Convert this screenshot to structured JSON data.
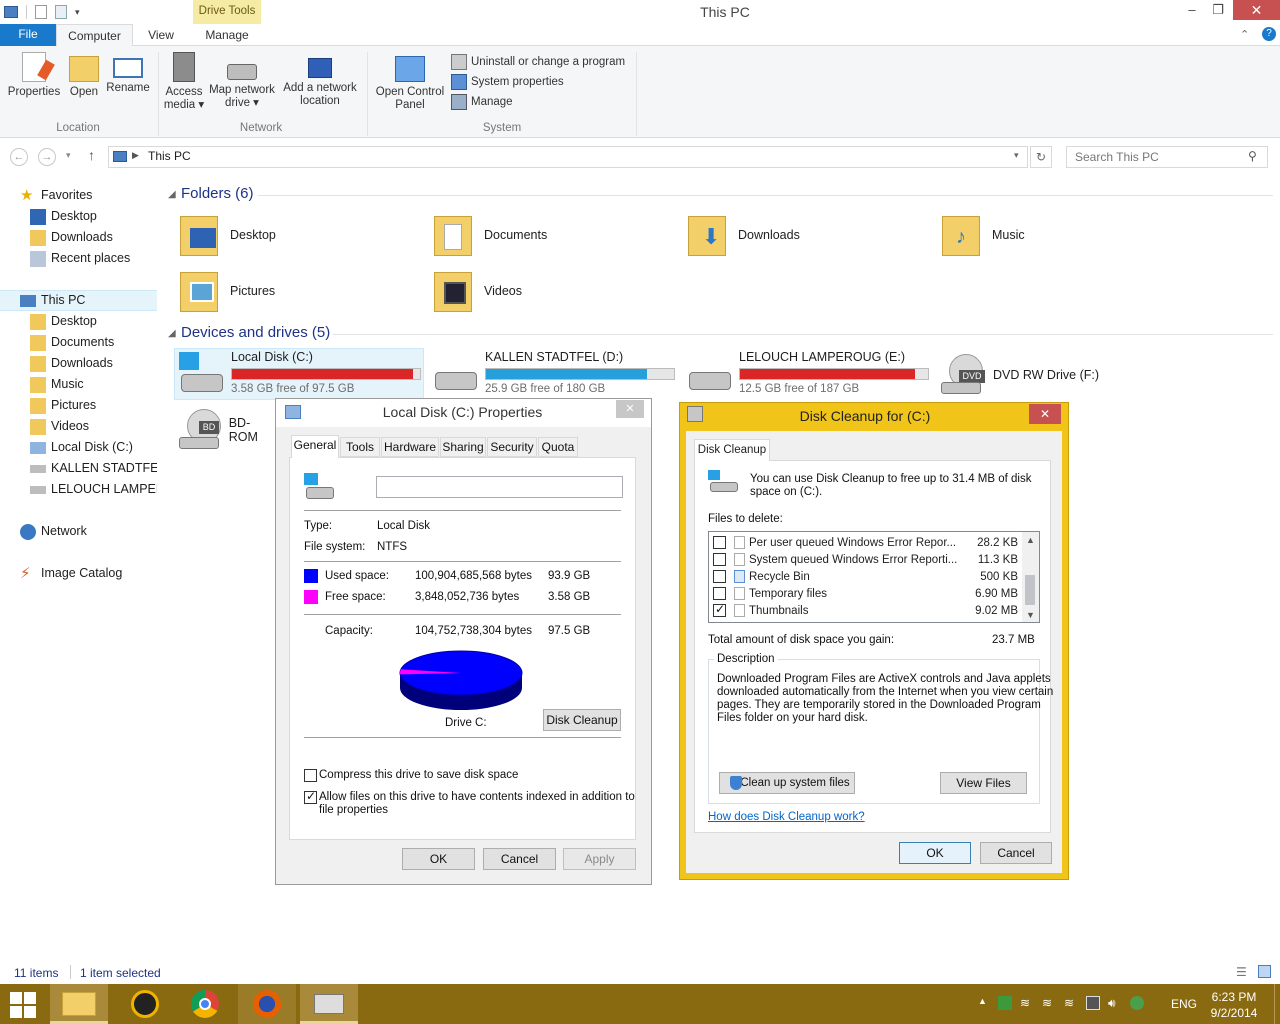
{
  "window": {
    "title": "This PC",
    "context_tab": "Drive Tools",
    "minimize": "–",
    "maximize": "❐",
    "close": "✕"
  },
  "ribbon": {
    "tabs": [
      "File",
      "Computer",
      "View",
      "Manage"
    ],
    "location": {
      "label": "Location",
      "items": [
        "Properties",
        "Open",
        "Rename"
      ]
    },
    "network": {
      "label": "Network",
      "access": [
        "Access",
        "media ▾"
      ],
      "map": [
        "Map network",
        "drive ▾"
      ],
      "add": [
        "Add a network",
        "location"
      ]
    },
    "system": {
      "label": "System",
      "control_panel": [
        "Open Control",
        "Panel"
      ],
      "uninstall": "Uninstall or change a program",
      "sys_props": "System properties",
      "manage": "Manage"
    }
  },
  "address": {
    "path": "This PC",
    "search_placeholder": "Search This PC"
  },
  "nav": {
    "favorites": {
      "label": "Favorites",
      "items": [
        "Desktop",
        "Downloads",
        "Recent places"
      ]
    },
    "this_pc": {
      "label": "This PC",
      "items": [
        "Desktop",
        "Documents",
        "Downloads",
        "Music",
        "Pictures",
        "Videos",
        "Local Disk (C:)",
        "KALLEN STADTFEL (",
        "LELOUCH LAMPERO"
      ]
    },
    "network": "Network",
    "image_catalog": "Image Catalog"
  },
  "folders": {
    "header": "Folders (6)",
    "items": [
      "Desktop",
      "Documents",
      "Downloads",
      "Music",
      "Pictures",
      "Videos"
    ]
  },
  "drives": {
    "header": "Devices and drives (5)",
    "items": [
      {
        "name": "Local Disk (C:)",
        "free": "3.58 GB free of 97.5 GB",
        "used_fraction": 0.963,
        "color": "#da2626"
      },
      {
        "name": "KALLEN STADTFEL (D:)",
        "free": "25.9 GB free of 180 GB",
        "used_fraction": 0.856,
        "color": "#26a0da"
      },
      {
        "name": "LELOUCH LAMPEROUG (E:)",
        "free": "12.5 GB free of 187 GB",
        "used_fraction": 0.933,
        "color": "#da2626"
      },
      {
        "name": "DVD RW Drive (F:)",
        "badge": "DVD"
      },
      {
        "name": "BD-ROM",
        "badge": "BD"
      }
    ]
  },
  "status": {
    "items": "11 items",
    "selected": "1 item selected"
  },
  "taskbar": {
    "time": "6:23 PM",
    "date": "9/2/2014",
    "lang": "ENG"
  },
  "properties": {
    "title": "Local Disk (C:) Properties",
    "tabs": [
      "General",
      "Tools",
      "Hardware",
      "Sharing",
      "Security",
      "Quota"
    ],
    "name_value": "",
    "type_label": "Type:",
    "type_value": "Local Disk",
    "fs_label": "File system:",
    "fs_value": "NTFS",
    "used_label": "Used space:",
    "used_bytes": "100,904,685,568 bytes",
    "used_gb": "93.9 GB",
    "free_label": "Free space:",
    "free_bytes": "3,848,052,736 bytes",
    "free_gb": "3.58 GB",
    "cap_label": "Capacity:",
    "cap_bytes": "104,752,738,304 bytes",
    "cap_gb": "97.5 GB",
    "used_fraction": 0.963,
    "used_color": "#0000ff",
    "free_color": "#ff00ff",
    "drive_label": "Drive C:",
    "cleanup_button": "Disk Cleanup",
    "compress": "Compress this drive to save disk space",
    "index1": "Allow files on this drive to have contents indexed in addition to",
    "index2": "file properties",
    "compress_checked": false,
    "index_checked": true,
    "ok": "OK",
    "cancel": "Cancel",
    "apply": "Apply"
  },
  "cleanup": {
    "title": "Disk Cleanup for  (C:)",
    "tab": "Disk Cleanup",
    "intro1": "You can use Disk Cleanup to free up to 31.4 MB of disk",
    "intro2": "space on  (C:).",
    "files_label": "Files to delete:",
    "files": [
      {
        "name": "Per user queued Windows Error Repor...",
        "size": "28.2 KB",
        "checked": false
      },
      {
        "name": "System queued Windows Error Reporti...",
        "size": "11.3 KB",
        "checked": false
      },
      {
        "name": "Recycle Bin",
        "size": "500 KB",
        "checked": false
      },
      {
        "name": "Temporary files",
        "size": "6.90 MB",
        "checked": false
      },
      {
        "name": "Thumbnails",
        "size": "9.02 MB",
        "checked": true
      }
    ],
    "total_label": "Total amount of disk space you gain:",
    "total_value": "23.7 MB",
    "desc_label": "Description",
    "desc": [
      "Downloaded Program Files are ActiveX controls and Java applets",
      "downloaded automatically from the Internet when you view certain",
      "pages. They are temporarily stored in the Downloaded Program",
      "Files folder on your hard disk."
    ],
    "cleanup_sys": "Clean up system files",
    "view_files": "View Files",
    "how_link": "How does Disk Cleanup work?",
    "ok": "OK",
    "cancel": "Cancel"
  }
}
